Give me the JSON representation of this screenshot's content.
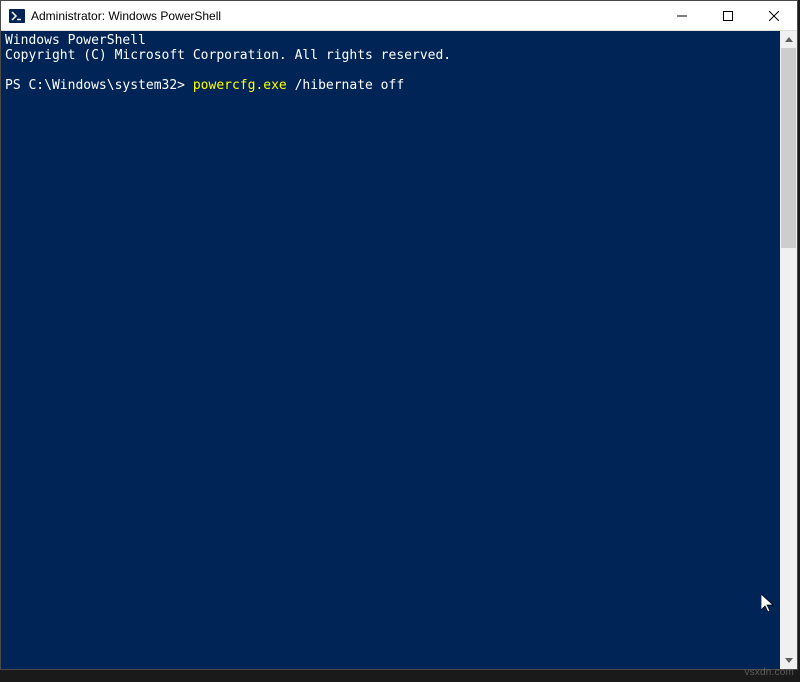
{
  "window": {
    "title": "Administrator: Windows PowerShell"
  },
  "terminal": {
    "banner_line1": "Windows PowerShell",
    "banner_line2": "Copyright (C) Microsoft Corporation. All rights reserved.",
    "prompt": "PS C:\\Windows\\system32> ",
    "command": "powercfg.exe",
    "args": " /hibernate off"
  },
  "colors": {
    "terminal_bg": "#012456",
    "terminal_fg": "#ffffff",
    "command_fg": "#ffff00"
  },
  "watermark": "vsxdn.com"
}
